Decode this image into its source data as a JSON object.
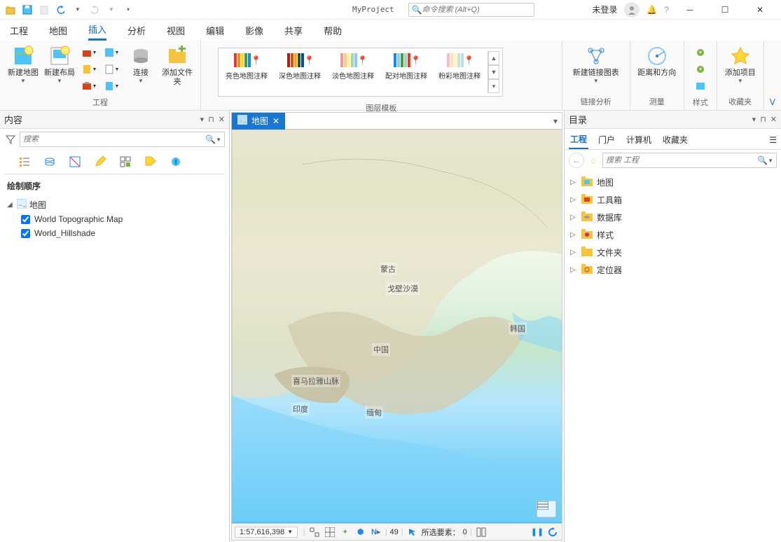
{
  "titlebar": {
    "project_name": "MyProject",
    "search_placeholder": "命令搜索 (Alt+Q)",
    "user_status": "未登录"
  },
  "menu": {
    "tabs": [
      "工程",
      "地图",
      "插入",
      "分析",
      "视图",
      "编辑",
      "影像",
      "共享",
      "帮助"
    ],
    "active_index": 2
  },
  "ribbon": {
    "group_project": {
      "label": "工程",
      "new_map": "新建地图",
      "new_layout": "新建布局",
      "connect": "连接",
      "add_folder": "添加文件夹"
    },
    "group_gallery": {
      "label": "图层模板",
      "items": [
        "亮色地图注释",
        "深色地图注释",
        "淡色地图注释",
        "配对地图注释",
        "粉彩地图注释"
      ]
    },
    "group_link": {
      "label": "链接分析",
      "btn": "新建链接图表"
    },
    "group_measure": {
      "label": "测量",
      "btn": "距离和方向"
    },
    "group_style": {
      "label": "样式"
    },
    "group_fav": {
      "label": "收藏夹",
      "btn": "添加项目"
    }
  },
  "content_panel": {
    "title": "内容",
    "search_placeholder": "搜索",
    "tree_heading": "绘制顺序",
    "root": "地图",
    "layers": [
      "World Topographic Map",
      "World_Hillshade"
    ]
  },
  "catalog_panel": {
    "title": "目录",
    "tabs": [
      "工程",
      "门户",
      "计算机",
      "收藏夹"
    ],
    "active_index": 0,
    "search_placeholder": "搜索 工程",
    "items": [
      "地图",
      "工具箱",
      "数据库",
      "样式",
      "文件夹",
      "定位器"
    ]
  },
  "map_view": {
    "tab_label": "地图",
    "scale": "1:57,616,398",
    "rotation": "49",
    "selection_label": "所选要素：",
    "selection_count": "0",
    "labels": {
      "mongolia": "蒙古",
      "gobi": "戈壁沙漠",
      "china": "中国",
      "himalaya": "喜马拉雅山脉",
      "india": "印度",
      "myanmar": "缅甸",
      "korea": "韩国"
    }
  },
  "colors": {
    "accent": "#1976d2",
    "swatch_bright": [
      "#e53935",
      "#fb8c00",
      "#fdd835",
      "#43a047",
      "#1e88e5"
    ],
    "swatch_dark": [
      "#b71c1c",
      "#e65100",
      "#f9a825",
      "#1b5e20",
      "#0d47a1"
    ],
    "swatch_light": [
      "#ef9a9a",
      "#ffcc80",
      "#fff59d",
      "#a5d6a7",
      "#90caf9"
    ],
    "swatch_pair": [
      "#1e88e5",
      "#90caf9",
      "#43a047",
      "#a5d6a7",
      "#e53935"
    ],
    "swatch_pastel": [
      "#f8bbd0",
      "#ffe0b2",
      "#fff9c4",
      "#c8e6c9",
      "#bbdefb"
    ]
  }
}
